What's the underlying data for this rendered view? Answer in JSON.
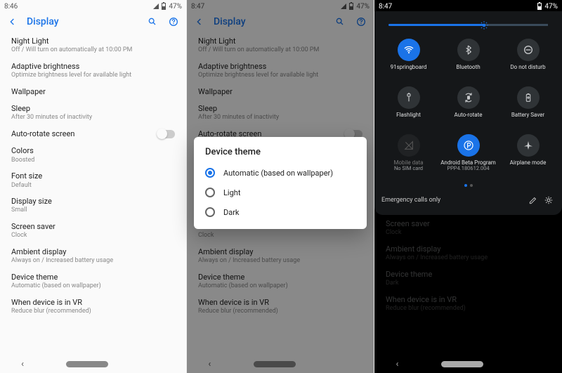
{
  "status": {
    "time_p1": "8:46",
    "time_p2": "8:47",
    "time_p3": "8:47",
    "battery": "47%"
  },
  "display_page": {
    "title": "Display",
    "items": [
      {
        "title": "Night Light",
        "sub": "Off / Will turn on automatically at 10:00 PM"
      },
      {
        "title": "Adaptive brightness",
        "sub": "Optimize brightness level for available light"
      },
      {
        "title": "Wallpaper",
        "sub": ""
      },
      {
        "title": "Sleep",
        "sub": "After 30 minutes of inactivity"
      },
      {
        "title": "Auto-rotate screen",
        "sub": ""
      },
      {
        "title": "Colors",
        "sub": "Boosted"
      },
      {
        "title": "Font size",
        "sub": "Default"
      },
      {
        "title": "Display size",
        "sub": "Small"
      },
      {
        "title": "Screen saver",
        "sub": "Clock"
      },
      {
        "title": "Ambient display",
        "sub": "Always on / Increased battery usage"
      },
      {
        "title": "Device theme",
        "sub": "Automatic (based on wallpaper)"
      },
      {
        "title": "When device is in VR",
        "sub": "Reduce blur (recommended)"
      }
    ],
    "items_p3": [
      {
        "title": "Screen saver",
        "sub": "Clock"
      },
      {
        "title": "Ambient display",
        "sub": "Always on / Increased battery usage"
      },
      {
        "title": "Device theme",
        "sub": "Dark"
      },
      {
        "title": "When device is in VR",
        "sub": "Reduce blur (recommended)"
      }
    ]
  },
  "dialog": {
    "title": "Device theme",
    "options": [
      "Automatic (based on wallpaper)",
      "Light",
      "Dark"
    ],
    "selected": 0
  },
  "qs": {
    "tiles": [
      {
        "icon": "wifi",
        "label": "91springboard",
        "active": true
      },
      {
        "icon": "bluetooth",
        "label": "Bluetooth",
        "active": false
      },
      {
        "icon": "do-not-disturb",
        "label": "Do not disturb",
        "active": false
      },
      {
        "icon": "flashlight",
        "label": "Flashlight",
        "active": false
      },
      {
        "icon": "auto-rotate",
        "label": "Auto-rotate",
        "active": false
      },
      {
        "icon": "battery-saver",
        "label": "Battery Saver",
        "active": false
      },
      {
        "icon": "mobile-data",
        "label": "Mobile data",
        "sub": "No SIM card",
        "disabled": true
      },
      {
        "icon": "android-beta",
        "label": "Android Beta Program",
        "sub": "PPP4.180612.004",
        "active": true
      },
      {
        "icon": "airplane",
        "label": "Airplane mode",
        "active": false
      }
    ],
    "footer": "Emergency calls only"
  },
  "colors": {
    "accent": "#1a73e8"
  }
}
